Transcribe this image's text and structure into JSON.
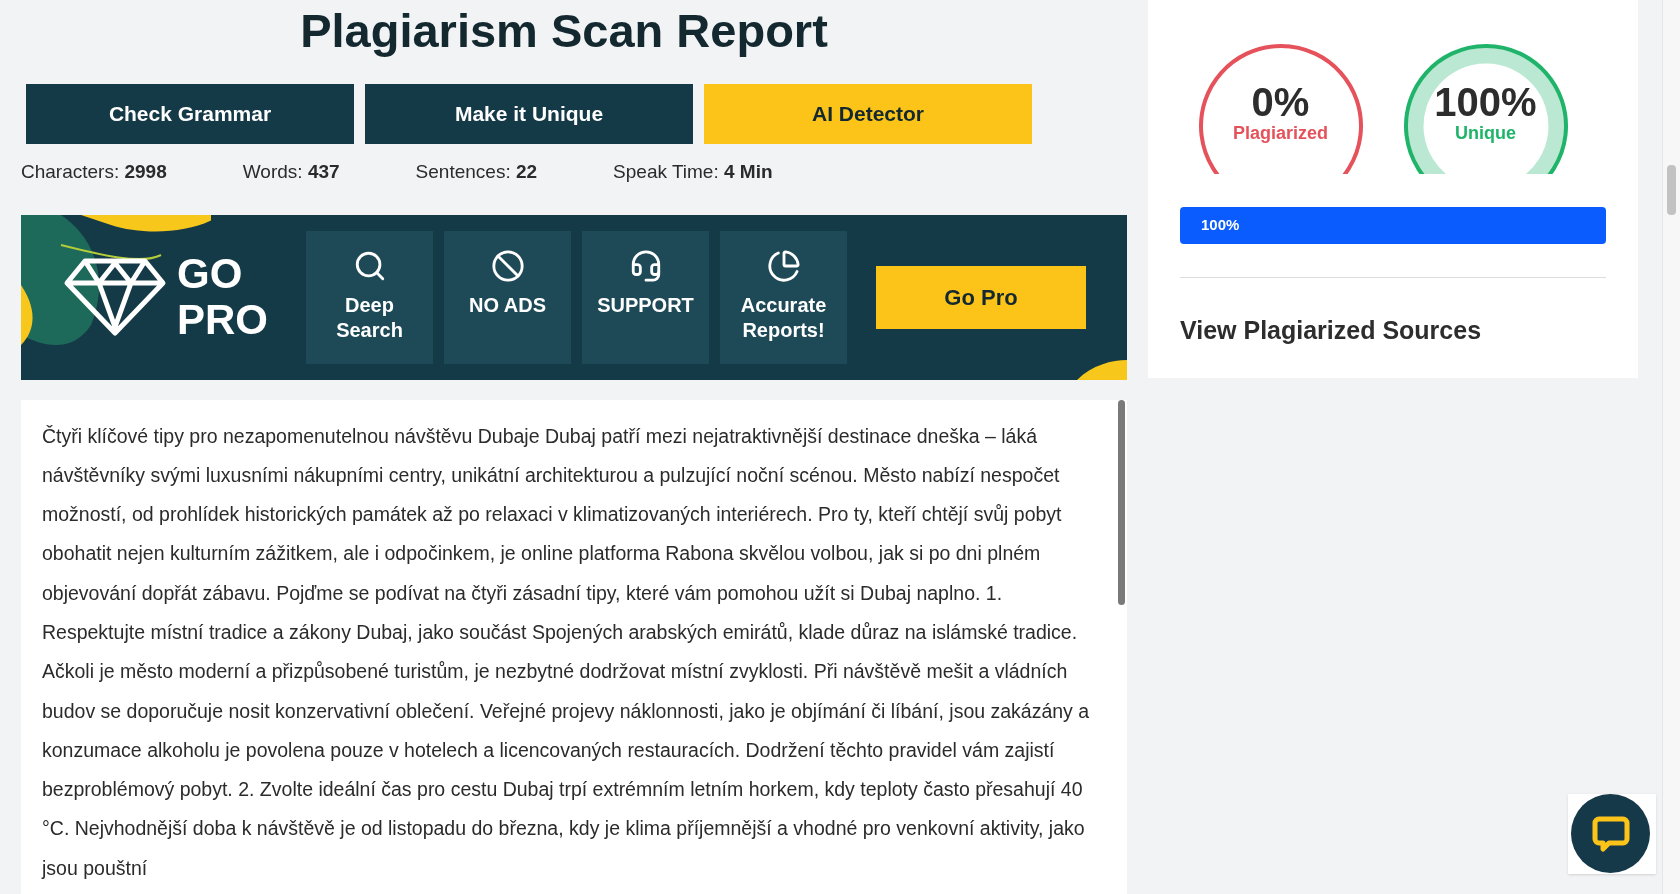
{
  "title": "Plagiarism Scan Report",
  "actions": [
    {
      "label": "Check Grammar",
      "kind": "dark"
    },
    {
      "label": "Make it Unique",
      "kind": "dark"
    },
    {
      "label": "AI Detector",
      "kind": "accent"
    }
  ],
  "stats": [
    {
      "label": "Characters:",
      "value": "2998"
    },
    {
      "label": "Words:",
      "value": "437"
    },
    {
      "label": "Sentences:",
      "value": "22"
    },
    {
      "label": "Speak Time:",
      "value": "4 Min"
    }
  ],
  "promo": {
    "logo_lines": [
      "GO",
      "PRO"
    ],
    "features": [
      {
        "label": "Deep Search",
        "kind": "search"
      },
      {
        "label": "NO ADS",
        "kind": "no-ads"
      },
      {
        "label": "SUPPORT",
        "kind": "support"
      },
      {
        "label": "Accurate Reports!",
        "kind": "reports"
      }
    ],
    "button": "Go Pro"
  },
  "document_text": "Čtyři klíčové tipy pro nezapomenutelnou návštěvu Dubaje Dubaj patří mezi nejatraktivnější destinace dneška – láká návštěvníky svými luxusními nákupními centry, unikátní architekturou a pulzující noční scénou. Město nabízí nespočet možností, od prohlídek historických památek až po relaxaci v klimatizovaných interiérech. Pro ty, kteří chtějí svůj pobyt obohatit nejen kulturním zážitkem, ale i odpočinkem, je online platforma Rabona skvělou volbou, jak si po dni plném objevování dopřát zábavu. Pojďme se podívat na čtyři zásadní tipy, které vám pomohou užít si Dubaj naplno. 1. Respektujte místní tradice a zákony Dubaj, jako součást Spojených arabských emirátů, klade důraz na islámské tradice. Ačkoli je město moderní a přizpůsobené turistům, je nezbytné dodržovat místní zvyklosti. Při návštěvě mešit a vládních budov se doporučuje nosit konzervativní oblečení. Veřejné projevy náklonnosti, jako je objímání či líbání, jsou zakázány a konzumace alkoholu je povolena pouze v hotelech a licencovaných restauracích. Dodržení těchto pravidel vám zajistí bezproblémový pobyt. 2. Zvolte ideální čas pro cestu Dubaj trpí extrémním letním horkem, kdy teploty často přesahují 40 °C. Nejvhodnější doba k návštěvě je od listopadu do března, kdy je klima příjemnější a vhodné pro venkovní aktivity, jako jsou pouštní",
  "results": {
    "gauges": [
      {
        "value": "0%",
        "label": "Plagiarized",
        "kind": "outline",
        "color": "#e5525b"
      },
      {
        "value": "100%",
        "label": "Unique",
        "kind": "banded",
        "color": "#1fb46a"
      }
    ],
    "progress": {
      "label": "100%",
      "level": 1
    },
    "sources_heading": "View Plagiarized Sources"
  }
}
